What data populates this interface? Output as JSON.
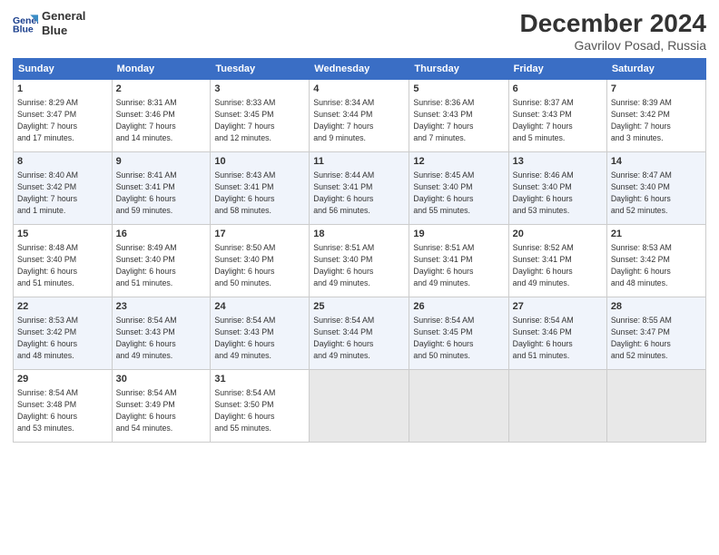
{
  "header": {
    "logo_line1": "General",
    "logo_line2": "Blue",
    "month": "December 2024",
    "location": "Gavrilov Posad, Russia"
  },
  "weekdays": [
    "Sunday",
    "Monday",
    "Tuesday",
    "Wednesday",
    "Thursday",
    "Friday",
    "Saturday"
  ],
  "weeks": [
    [
      {
        "day": "1",
        "info": "Sunrise: 8:29 AM\nSunset: 3:47 PM\nDaylight: 7 hours\nand 17 minutes."
      },
      {
        "day": "2",
        "info": "Sunrise: 8:31 AM\nSunset: 3:46 PM\nDaylight: 7 hours\nand 14 minutes."
      },
      {
        "day": "3",
        "info": "Sunrise: 8:33 AM\nSunset: 3:45 PM\nDaylight: 7 hours\nand 12 minutes."
      },
      {
        "day": "4",
        "info": "Sunrise: 8:34 AM\nSunset: 3:44 PM\nDaylight: 7 hours\nand 9 minutes."
      },
      {
        "day": "5",
        "info": "Sunrise: 8:36 AM\nSunset: 3:43 PM\nDaylight: 7 hours\nand 7 minutes."
      },
      {
        "day": "6",
        "info": "Sunrise: 8:37 AM\nSunset: 3:43 PM\nDaylight: 7 hours\nand 5 minutes."
      },
      {
        "day": "7",
        "info": "Sunrise: 8:39 AM\nSunset: 3:42 PM\nDaylight: 7 hours\nand 3 minutes."
      }
    ],
    [
      {
        "day": "8",
        "info": "Sunrise: 8:40 AM\nSunset: 3:42 PM\nDaylight: 7 hours\nand 1 minute."
      },
      {
        "day": "9",
        "info": "Sunrise: 8:41 AM\nSunset: 3:41 PM\nDaylight: 6 hours\nand 59 minutes."
      },
      {
        "day": "10",
        "info": "Sunrise: 8:43 AM\nSunset: 3:41 PM\nDaylight: 6 hours\nand 58 minutes."
      },
      {
        "day": "11",
        "info": "Sunrise: 8:44 AM\nSunset: 3:41 PM\nDaylight: 6 hours\nand 56 minutes."
      },
      {
        "day": "12",
        "info": "Sunrise: 8:45 AM\nSunset: 3:40 PM\nDaylight: 6 hours\nand 55 minutes."
      },
      {
        "day": "13",
        "info": "Sunrise: 8:46 AM\nSunset: 3:40 PM\nDaylight: 6 hours\nand 53 minutes."
      },
      {
        "day": "14",
        "info": "Sunrise: 8:47 AM\nSunset: 3:40 PM\nDaylight: 6 hours\nand 52 minutes."
      }
    ],
    [
      {
        "day": "15",
        "info": "Sunrise: 8:48 AM\nSunset: 3:40 PM\nDaylight: 6 hours\nand 51 minutes."
      },
      {
        "day": "16",
        "info": "Sunrise: 8:49 AM\nSunset: 3:40 PM\nDaylight: 6 hours\nand 51 minutes."
      },
      {
        "day": "17",
        "info": "Sunrise: 8:50 AM\nSunset: 3:40 PM\nDaylight: 6 hours\nand 50 minutes."
      },
      {
        "day": "18",
        "info": "Sunrise: 8:51 AM\nSunset: 3:40 PM\nDaylight: 6 hours\nand 49 minutes."
      },
      {
        "day": "19",
        "info": "Sunrise: 8:51 AM\nSunset: 3:41 PM\nDaylight: 6 hours\nand 49 minutes."
      },
      {
        "day": "20",
        "info": "Sunrise: 8:52 AM\nSunset: 3:41 PM\nDaylight: 6 hours\nand 49 minutes."
      },
      {
        "day": "21",
        "info": "Sunrise: 8:53 AM\nSunset: 3:42 PM\nDaylight: 6 hours\nand 48 minutes."
      }
    ],
    [
      {
        "day": "22",
        "info": "Sunrise: 8:53 AM\nSunset: 3:42 PM\nDaylight: 6 hours\nand 48 minutes."
      },
      {
        "day": "23",
        "info": "Sunrise: 8:54 AM\nSunset: 3:43 PM\nDaylight: 6 hours\nand 49 minutes."
      },
      {
        "day": "24",
        "info": "Sunrise: 8:54 AM\nSunset: 3:43 PM\nDaylight: 6 hours\nand 49 minutes."
      },
      {
        "day": "25",
        "info": "Sunrise: 8:54 AM\nSunset: 3:44 PM\nDaylight: 6 hours\nand 49 minutes."
      },
      {
        "day": "26",
        "info": "Sunrise: 8:54 AM\nSunset: 3:45 PM\nDaylight: 6 hours\nand 50 minutes."
      },
      {
        "day": "27",
        "info": "Sunrise: 8:54 AM\nSunset: 3:46 PM\nDaylight: 6 hours\nand 51 minutes."
      },
      {
        "day": "28",
        "info": "Sunrise: 8:55 AM\nSunset: 3:47 PM\nDaylight: 6 hours\nand 52 minutes."
      }
    ],
    [
      {
        "day": "29",
        "info": "Sunrise: 8:54 AM\nSunset: 3:48 PM\nDaylight: 6 hours\nand 53 minutes."
      },
      {
        "day": "30",
        "info": "Sunrise: 8:54 AM\nSunset: 3:49 PM\nDaylight: 6 hours\nand 54 minutes."
      },
      {
        "day": "31",
        "info": "Sunrise: 8:54 AM\nSunset: 3:50 PM\nDaylight: 6 hours\nand 55 minutes."
      },
      null,
      null,
      null,
      null
    ]
  ]
}
